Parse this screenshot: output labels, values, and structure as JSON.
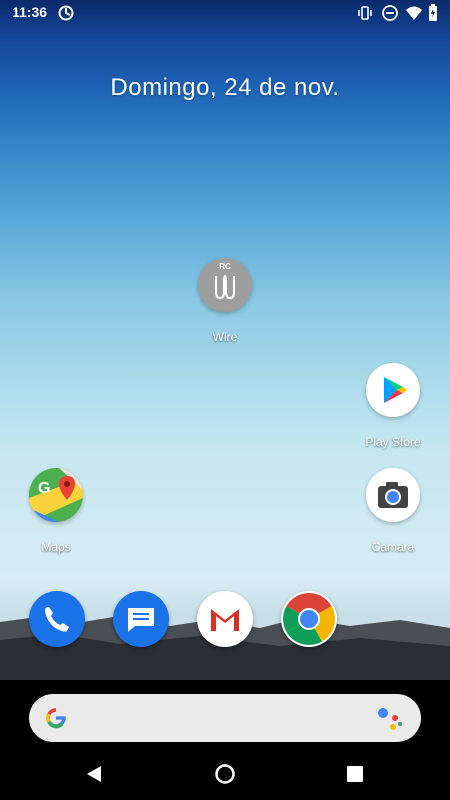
{
  "status_bar": {
    "time": "11:36",
    "left_icons": [
      "sync-icon"
    ],
    "right_icons": [
      "vibrate-icon",
      "do-not-disturb-icon",
      "wifi-icon",
      "battery-icon"
    ]
  },
  "home": {
    "date": "Domingo, 24 de nov."
  },
  "apps": [
    {
      "label": "Wire",
      "icon": "wire-icon",
      "badge": "RC"
    },
    {
      "label": "Play Store",
      "icon": "play-store-icon"
    },
    {
      "label": "Maps",
      "icon": "maps-icon"
    },
    {
      "label": "Camara",
      "icon": "camera-icon"
    }
  ],
  "dock": [
    "phone-icon",
    "messages-icon",
    "gmail-icon",
    "chrome-icon"
  ],
  "search_bar": {
    "left_icon": "google-icon",
    "right_icon": "assistant-icon"
  },
  "nav_bar": [
    "back-icon",
    "home-icon",
    "recents-icon"
  ],
  "colors": {
    "phone_blue": "#1a73e8",
    "messages_blue": "#1a73e8",
    "gmail_red": "#d93025",
    "wire_gray": "#9e9e9e",
    "search_bg": "#eaeaea"
  }
}
